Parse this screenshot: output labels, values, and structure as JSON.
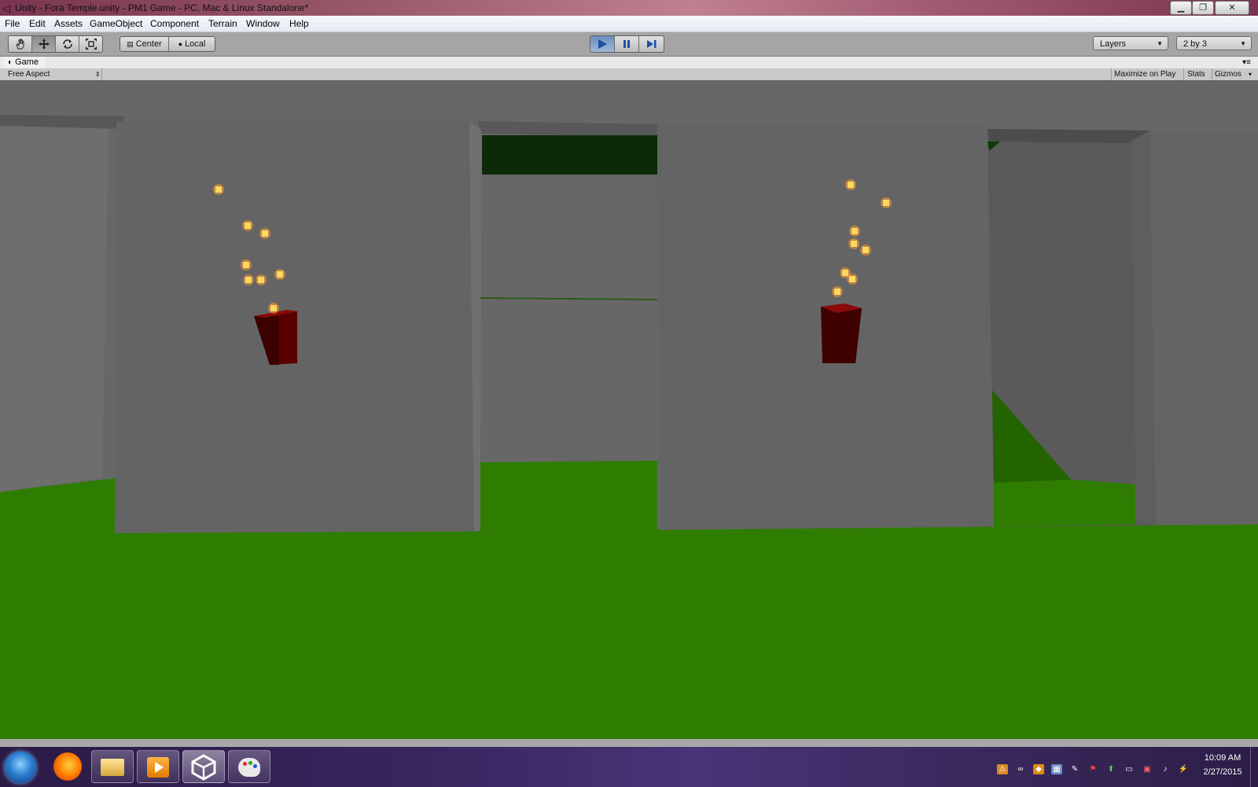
{
  "window": {
    "title": "Unity - Fora Temple.unity - PM1 Game - PC, Mac & Linux Standalone*",
    "minimize_glyph": "▁",
    "maximize_glyph": "❐",
    "close_glyph": "✕"
  },
  "menu": {
    "items": [
      "File",
      "Edit",
      "Assets",
      "GameObject",
      "Component",
      "Terrain",
      "Window",
      "Help"
    ]
  },
  "toolbar": {
    "tools": [
      "hand-icon",
      "move-icon",
      "rotate-icon",
      "scale-icon"
    ],
    "pivot_label": "Center",
    "space_label": "Local",
    "layers_label": "Layers",
    "layout_label": "2 by 3"
  },
  "game_tab": {
    "label": "Game",
    "aspect_label": "Free Aspect",
    "maximize_label": "Maximize on Play",
    "stats_label": "Stats",
    "gizmos_label": "Gizmos"
  },
  "taskbar": {
    "apps": [
      "start-orb-icon",
      "firefox-icon",
      "file-explorer-icon",
      "media-player-icon",
      "unity-icon",
      "paint-icon"
    ],
    "time": "10:09 AM",
    "date": "2/27/2015"
  },
  "colors": {
    "wall": "#666666",
    "grass": "#2e7d00",
    "brazier": "#6b0000",
    "ember": "#ffd860",
    "play_active": "#4a78c0"
  }
}
